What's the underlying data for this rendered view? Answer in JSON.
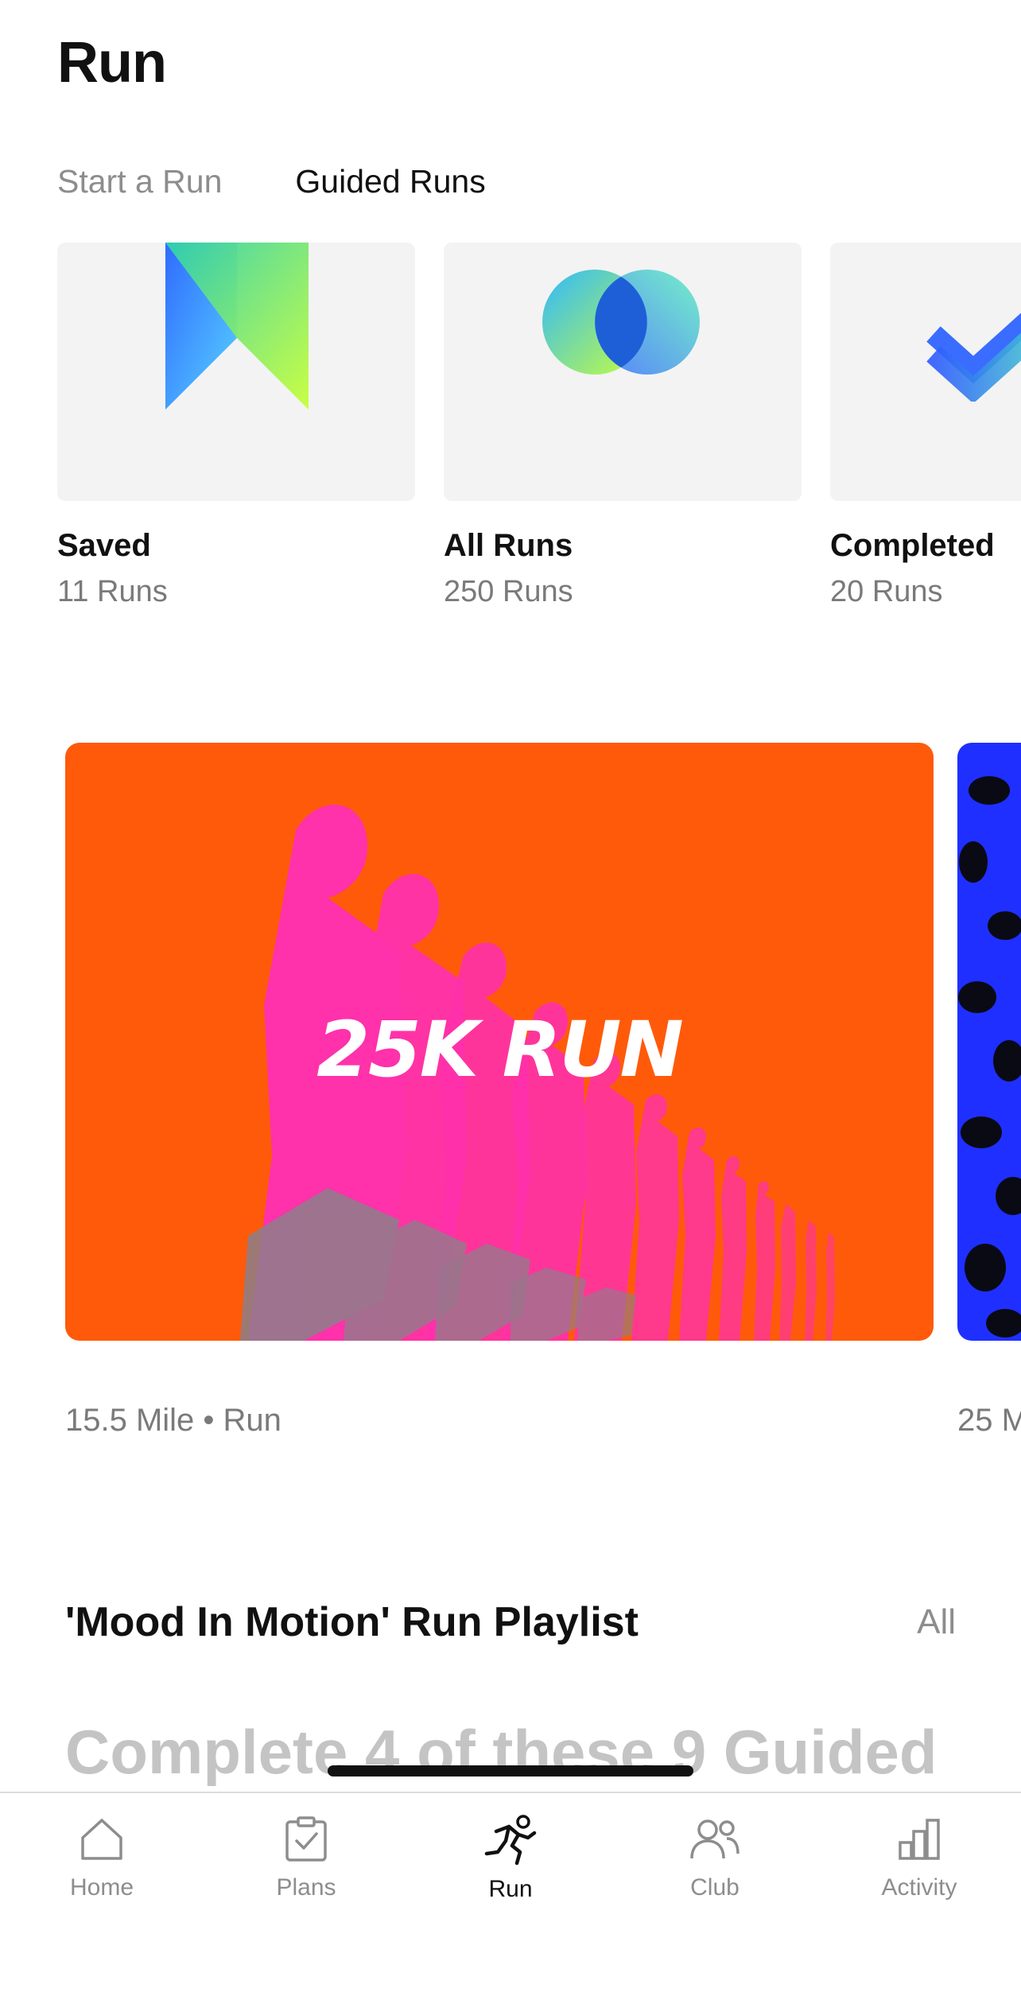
{
  "header": {
    "title": "Run"
  },
  "tabs": [
    {
      "label": "Start a Run",
      "active": false
    },
    {
      "label": "Guided Runs",
      "active": true
    }
  ],
  "collections": [
    {
      "name": "Saved",
      "count": "11 Runs",
      "icon": "bookmark-gradient-icon"
    },
    {
      "name": "All Runs",
      "count": "250 Runs",
      "icon": "overlap-circles-icon"
    },
    {
      "name": "Completed",
      "count": "20 Runs",
      "icon": "double-check-icon"
    }
  ],
  "featured_runs": [
    {
      "art_label": "25K RUN",
      "meta": "15.5 Mile • Run",
      "color": "#ff5a0a"
    },
    {
      "art_label": "",
      "meta": "25 M",
      "color": "#1f2fff"
    }
  ],
  "playlist": {
    "title": "'Mood In Motion' Run Playlist",
    "link": "All",
    "description": "Complete 4 of these 9 Guided"
  },
  "nav": [
    {
      "label": "Home",
      "icon": "home-icon",
      "active": false
    },
    {
      "label": "Plans",
      "icon": "clipboard-check-icon",
      "active": false
    },
    {
      "label": "Run",
      "icon": "runner-icon",
      "active": true
    },
    {
      "label": "Club",
      "icon": "people-icon",
      "active": false
    },
    {
      "label": "Activity",
      "icon": "bar-chart-icon",
      "active": false
    }
  ],
  "colors": {
    "accent_orange": "#ff5a0a",
    "accent_pink": "#ff2fb4",
    "accent_blue": "#1f2fff",
    "muted_text": "#8d8d8d"
  }
}
